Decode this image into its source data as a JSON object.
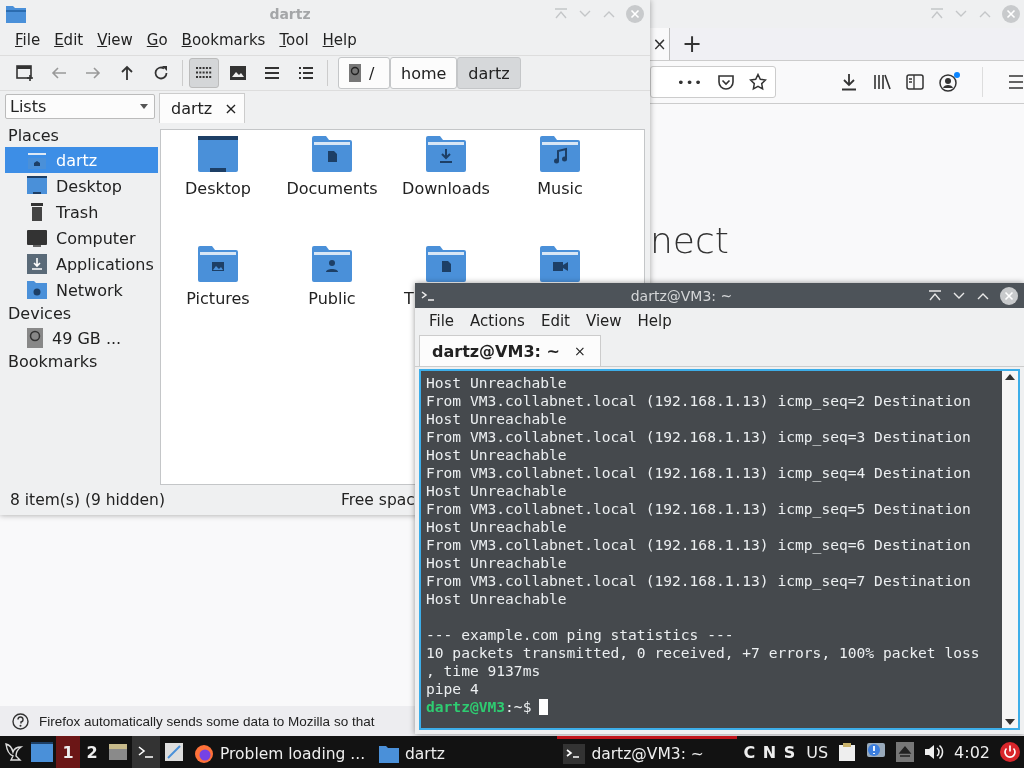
{
  "browser": {
    "tab_close": "×",
    "new_tab": "+",
    "url_more": "•••",
    "heading": "nect",
    "notification": "Firefox automatically sends some data to Mozilla so that"
  },
  "file_manager": {
    "title": "dartz",
    "menu": [
      "File",
      "Edit",
      "View",
      "Go",
      "Bookmarks",
      "Tool",
      "Help"
    ],
    "view_modes": [
      {
        "selected": true
      },
      {
        "selected": false
      },
      {
        "selected": false
      },
      {
        "selected": false
      }
    ],
    "path": [
      {
        "label": "/",
        "selected": false
      },
      {
        "label": "home",
        "selected": false
      },
      {
        "label": "dartz",
        "selected": true
      }
    ],
    "side_pane_mode": "Lists",
    "tab": {
      "label": "dartz",
      "close": "×"
    },
    "sidebar": [
      {
        "title": "Places",
        "items": [
          {
            "label": "dartz",
            "selected": true
          },
          {
            "label": "Desktop",
            "selected": false
          },
          {
            "label": "Trash",
            "selected": false
          },
          {
            "label": "Computer",
            "selected": false
          },
          {
            "label": "Applications",
            "selected": false
          },
          {
            "label": "Network",
            "selected": false
          }
        ]
      },
      {
        "title": "Devices",
        "items": [
          {
            "label": "49 GB ...",
            "selected": false
          }
        ]
      },
      {
        "title": "Bookmarks"
      }
    ],
    "files": [
      {
        "label": "Desktop",
        "kind": "full"
      },
      {
        "label": "Documents",
        "kind": "full"
      },
      {
        "label": "Downloads",
        "kind": "full"
      },
      {
        "label": "Music",
        "kind": "full"
      },
      {
        "label": "Pictures",
        "kind": "full"
      },
      {
        "label": "Public",
        "kind": "full"
      },
      {
        "label": "T",
        "kind": "clipped"
      },
      {
        "kind": "clipped"
      }
    ],
    "status": {
      "count": "8 item(s) (9 hidden)",
      "free_space": "Free spac"
    }
  },
  "terminal": {
    "title": "dartz@VM3: ~",
    "menu": [
      "File",
      "Actions",
      "Edit",
      "View",
      "Help"
    ],
    "tab": {
      "label": "dartz@VM3: ~",
      "close": "×"
    },
    "lines": [
      "Host Unreachable",
      "From VM3.collabnet.local (192.168.1.13) icmp_seq=2 Destination",
      "Host Unreachable",
      "From VM3.collabnet.local (192.168.1.13) icmp_seq=3 Destination",
      "Host Unreachable",
      "From VM3.collabnet.local (192.168.1.13) icmp_seq=4 Destination",
      "Host Unreachable",
      "From VM3.collabnet.local (192.168.1.13) icmp_seq=5 Destination",
      "Host Unreachable",
      "From VM3.collabnet.local (192.168.1.13) icmp_seq=6 Destination",
      "Host Unreachable",
      "From VM3.collabnet.local (192.168.1.13) icmp_seq=7 Destination",
      "Host Unreachable"
    ],
    "summary": [
      "--- example.com ping statistics ---",
      "10 packets transmitted, 0 received, +7 errors, 100% packet loss",
      ", time 9137ms",
      "pipe 4"
    ],
    "prompt": {
      "user_host": "dartz@VM3",
      "path": ":~$"
    }
  },
  "taskbar": {
    "workspaces": [
      {
        "label": "1",
        "selected": true
      },
      {
        "label": "2",
        "selected": false
      }
    ],
    "tasks": [
      {
        "label": "Problem loading ...",
        "active": false
      },
      {
        "label": "dartz",
        "active": false
      },
      {
        "label": "dartz@VM3: ~",
        "active": true
      }
    ],
    "indicators": "C N S",
    "keyboard_layout": "US",
    "clock": "4:02"
  }
}
